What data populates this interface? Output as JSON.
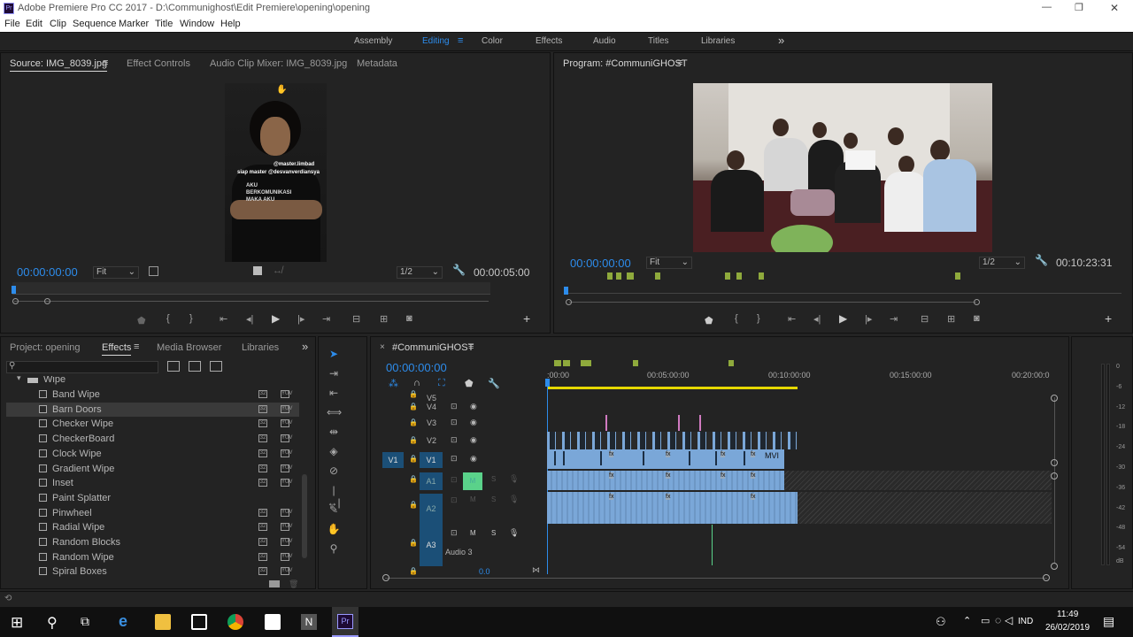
{
  "app": {
    "title": "Adobe Premiere Pro CC 2017 - D:\\Communighost\\Edit Premiere\\opening\\opening",
    "window_buttons": [
      "—",
      "❐",
      "✕"
    ]
  },
  "menu": [
    "File",
    "Edit",
    "Clip",
    "Sequence",
    "Marker",
    "Title",
    "Window",
    "Help"
  ],
  "workspaces": [
    "Assembly",
    "Editing",
    "Color",
    "Effects",
    "Audio",
    "Titles",
    "Libraries"
  ],
  "workspace_more": "»",
  "source_panel": {
    "tabs": [
      "Source: IMG_8039.jpg",
      "Effect Controls",
      "Audio Clip Mixer: IMG_8039.jpg",
      "Metadata"
    ],
    "timecode_in": "00:00:00:00",
    "fit": "Fit",
    "resolution": "1/2",
    "timecode_out": "00:00:05:00",
    "overlay": {
      "handle": "@master.limbad",
      "caption": "siap master @desvanverdiansya",
      "shirt_1": "AKU",
      "shirt_2": "BERKOMUNIKASI",
      "shirt_3": "MAKA AKU"
    }
  },
  "program_panel": {
    "tab": "Program: #CommuniGHOST",
    "timecode_in": "00:00:00:00",
    "fit": "Fit",
    "resolution": "1/2",
    "timecode_out": "00:10:23:31"
  },
  "project_panel": {
    "tabs": [
      "Project: opening",
      "Effects",
      "Media Browser",
      "Libraries"
    ],
    "more": "»",
    "search_placeholder": "",
    "folder": "Wipe",
    "badge_labels": [
      "32",
      "YUV"
    ],
    "items": [
      {
        "name": "Band Wipe",
        "badges": true
      },
      {
        "name": "Barn Doors",
        "badges": true
      },
      {
        "name": "Checker Wipe",
        "badges": true
      },
      {
        "name": "CheckerBoard",
        "badges": true
      },
      {
        "name": "Clock Wipe",
        "badges": true
      },
      {
        "name": "Gradient Wipe",
        "badges": true
      },
      {
        "name": "Inset",
        "badges": true
      },
      {
        "name": "Paint Splatter",
        "badges": false
      },
      {
        "name": "Pinwheel",
        "badges": true
      },
      {
        "name": "Radial Wipe",
        "badges": true
      },
      {
        "name": "Random Blocks",
        "badges": true
      },
      {
        "name": "Random Wipe",
        "badges": true
      },
      {
        "name": "Spiral Boxes",
        "badges": true
      }
    ]
  },
  "timeline": {
    "tab": "#CommuniGHOST",
    "timecode": "00:00:00:00",
    "ruler": [
      ":00:00",
      "00:05:00:00",
      "00:10:00:00",
      "00:15:00:00",
      "00:20:00:0"
    ],
    "tracks": {
      "v5": "V5",
      "v4": "V4",
      "v3": "V3",
      "v2": "V2",
      "v1": "V1",
      "v1_src": "V1",
      "a1": "A1",
      "a2": "A2",
      "a3": "A3",
      "a3_name": "Audio 3",
      "m": "M",
      "s": "S"
    },
    "clip_label": "MVI",
    "fx_badge": "fx",
    "zoom_value": "0.0"
  },
  "meter": {
    "labels": [
      "0",
      "-6",
      "-12",
      "-18",
      "-24",
      "-30",
      "-36",
      "-42",
      "-48",
      "-54"
    ],
    "unit": "dB"
  },
  "taskbar": {
    "lang": "IND",
    "time": "11:49",
    "date": "26/02/2019"
  },
  "colors": {
    "accent": "#2d8ceb",
    "panel": "#232323",
    "clip": "#7aa7d8",
    "playhead_yellow": "#e6d800",
    "marker_green": "#8faa3c"
  }
}
